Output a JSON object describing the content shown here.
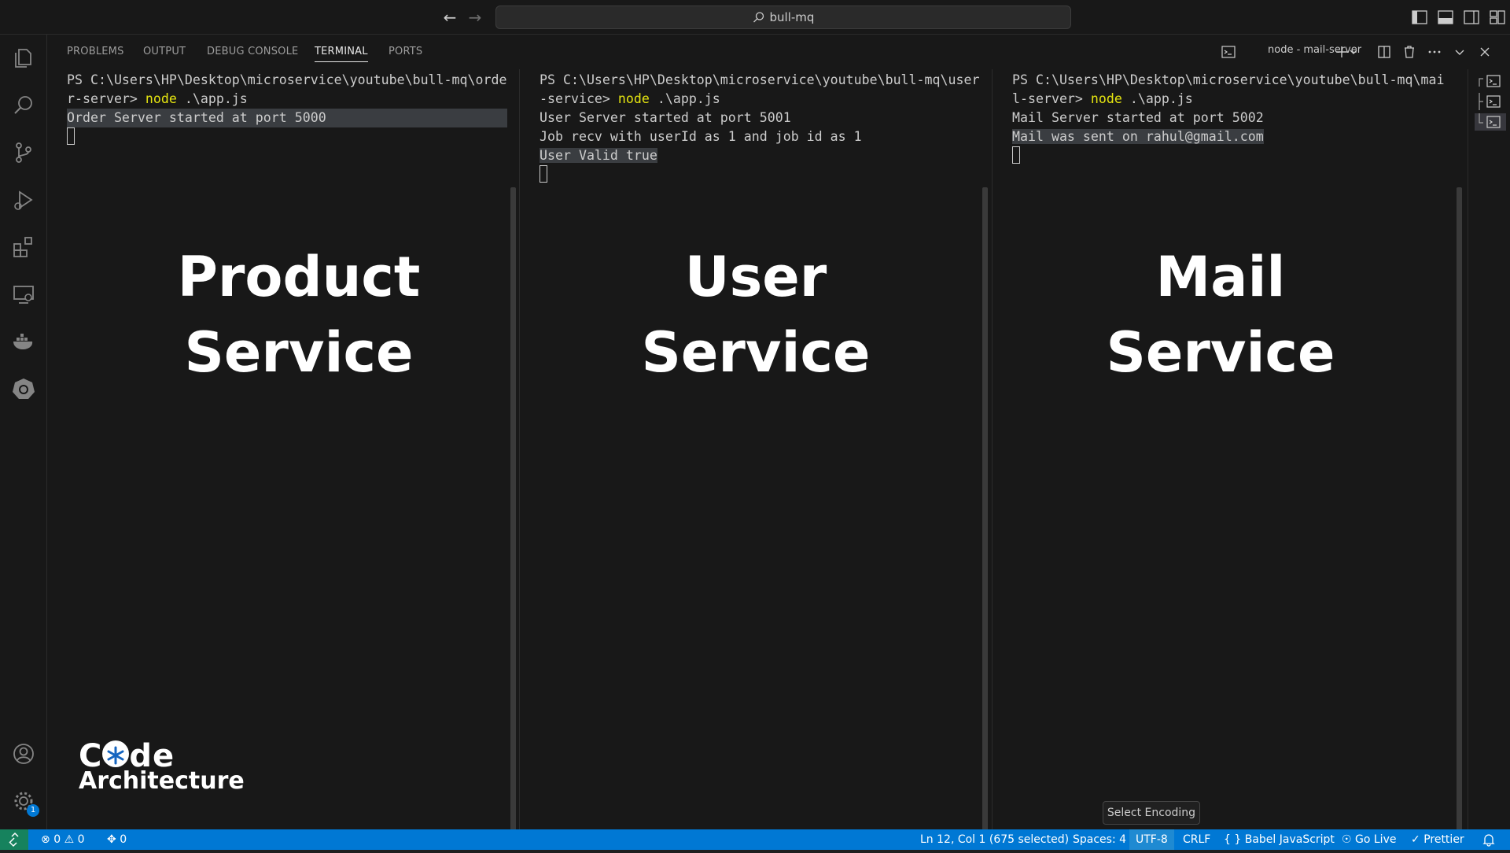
{
  "titlebar": {
    "search_text": "bull-mq",
    "back_icon": "arrow-left-icon",
    "forward_icon": "arrow-right-icon"
  },
  "panel": {
    "tabs": [
      {
        "label": "PROBLEMS",
        "active": false
      },
      {
        "label": "OUTPUT",
        "active": false
      },
      {
        "label": "DEBUG CONSOLE",
        "active": false
      },
      {
        "label": "TERMINAL",
        "active": true
      },
      {
        "label": "PORTS",
        "active": false
      }
    ],
    "terminal_name": "node - mail-server"
  },
  "terminals": [
    {
      "line1": "PS C:\\Users\\HP\\Desktop\\microservice\\youtube\\bull-mq\\orde",
      "line2_prefix": "r-server> ",
      "cmd": "node",
      "args": " .\\app.js",
      "output": [
        "Order Server started at port 5000"
      ],
      "overlay": [
        "Product",
        "Service"
      ]
    },
    {
      "line1": "PS C:\\Users\\HP\\Desktop\\microservice\\youtube\\bull-mq\\user",
      "line2_prefix": "-service> ",
      "cmd": "node",
      "args": " .\\app.js",
      "output": [
        "User Server started at port 5001",
        "Job recv with userId as 1 and job id as 1",
        "User Valid true"
      ],
      "overlay": [
        "User",
        "Service"
      ]
    },
    {
      "line1": "PS C:\\Users\\HP\\Desktop\\microservice\\youtube\\bull-mq\\mai",
      "line2_prefix": "l-server> ",
      "cmd": "node",
      "args": " .\\app.js",
      "output": [
        "Mail Server started at port 5002",
        "Mail was sent on rahul@gmail.com"
      ],
      "overlay": [
        "Mail",
        "Service"
      ]
    }
  ],
  "logo": {
    "line1_a": "C",
    "line1_b": "de",
    "line2": "Architecture"
  },
  "tooltip": "Select Encoding",
  "statusbar": {
    "errors": "0",
    "warnings": "0",
    "ports": "0",
    "cursor": "Ln 12, Col 1 (675 selected)",
    "spaces": "Spaces: 4",
    "encoding": "UTF-8",
    "eol": "CRLF",
    "language": "Babel JavaScript",
    "golive": "Go Live",
    "prettier": "Prettier"
  },
  "activity": {
    "settings_badge": "1"
  },
  "colors": {
    "statusbar": "#0078d4",
    "terminal_bg": "#181818",
    "command": "#e5e510"
  }
}
